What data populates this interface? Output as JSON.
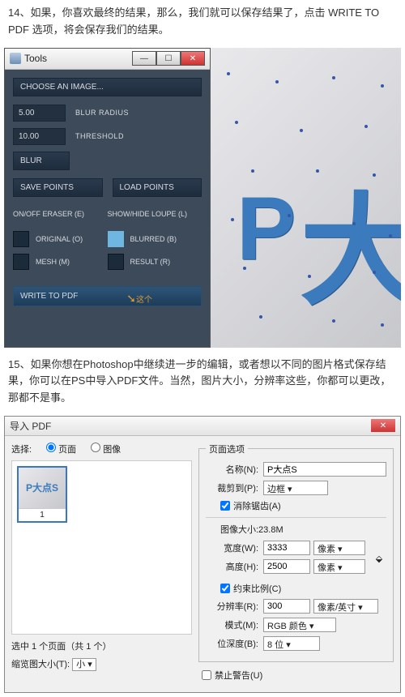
{
  "para1": "14、如果，你喜欢最终的结果，那么，我们就可以保存结果了，点击 WRITE TO PDF 选项，将会保存我们的结果。",
  "para2": "15、如果你想在Photoshop中继续进一步的编辑，或者想以不同的图片格式保存结果，你可以在PS中导入PDF文件。当然，图片大小，分辨率这些，你都可以更改，那都不是事。",
  "tools": {
    "title": "Tools",
    "choose": "CHOOSE AN IMAGE...",
    "blur_radius_val": "5.00",
    "blur_radius_lbl": "BLUR RADIUS",
    "threshold_val": "10.00",
    "threshold_lbl": "THRESHOLD",
    "blur_btn": "BLUR",
    "save_points": "SAVE POINTS",
    "load_points": "LOAD POINTS",
    "eraser": "ON/OFF ERASER (E)",
    "loupe": "SHOW/HIDE LOUPE (L)",
    "original": "ORIGINAL (O)",
    "blurred": "BLURRED (B)",
    "mesh": "MESH (M)",
    "result": "RESULT (R)",
    "write_pdf": "WRITE TO PDF",
    "annot": "这个"
  },
  "preview": {
    "p": "P",
    "da": "大"
  },
  "dlg": {
    "title": "导入 PDF",
    "select_label": "选择:",
    "page": "页面",
    "image": "图像",
    "thumb_text": "P大点S",
    "thumb_num": "1",
    "selected": "选中 1 个页面（共 1 个）",
    "thumb_size_lbl": "缩览图大小(T):",
    "thumb_size_val": "小",
    "page_options": "页面选项",
    "name_lbl": "名称(N):",
    "name_val": "P大点S",
    "crop_lbl": "裁剪到(P):",
    "crop_val": "边框",
    "antialias": "消除锯齿(A)",
    "imgsize": "图像大小:23.8M",
    "width_lbl": "宽度(W):",
    "width_val": "3333",
    "height_lbl": "高度(H):",
    "height_val": "2500",
    "px": "像素",
    "constrain": "约束比例(C)",
    "res_lbl": "分辨率(R):",
    "res_val": "300",
    "res_unit": "像素/英寸",
    "mode_lbl": "模式(M):",
    "mode_val": "RGB 颜色",
    "depth_lbl": "位深度(B):",
    "depth_val": "8 位",
    "suppress": "禁止警告(U)"
  }
}
